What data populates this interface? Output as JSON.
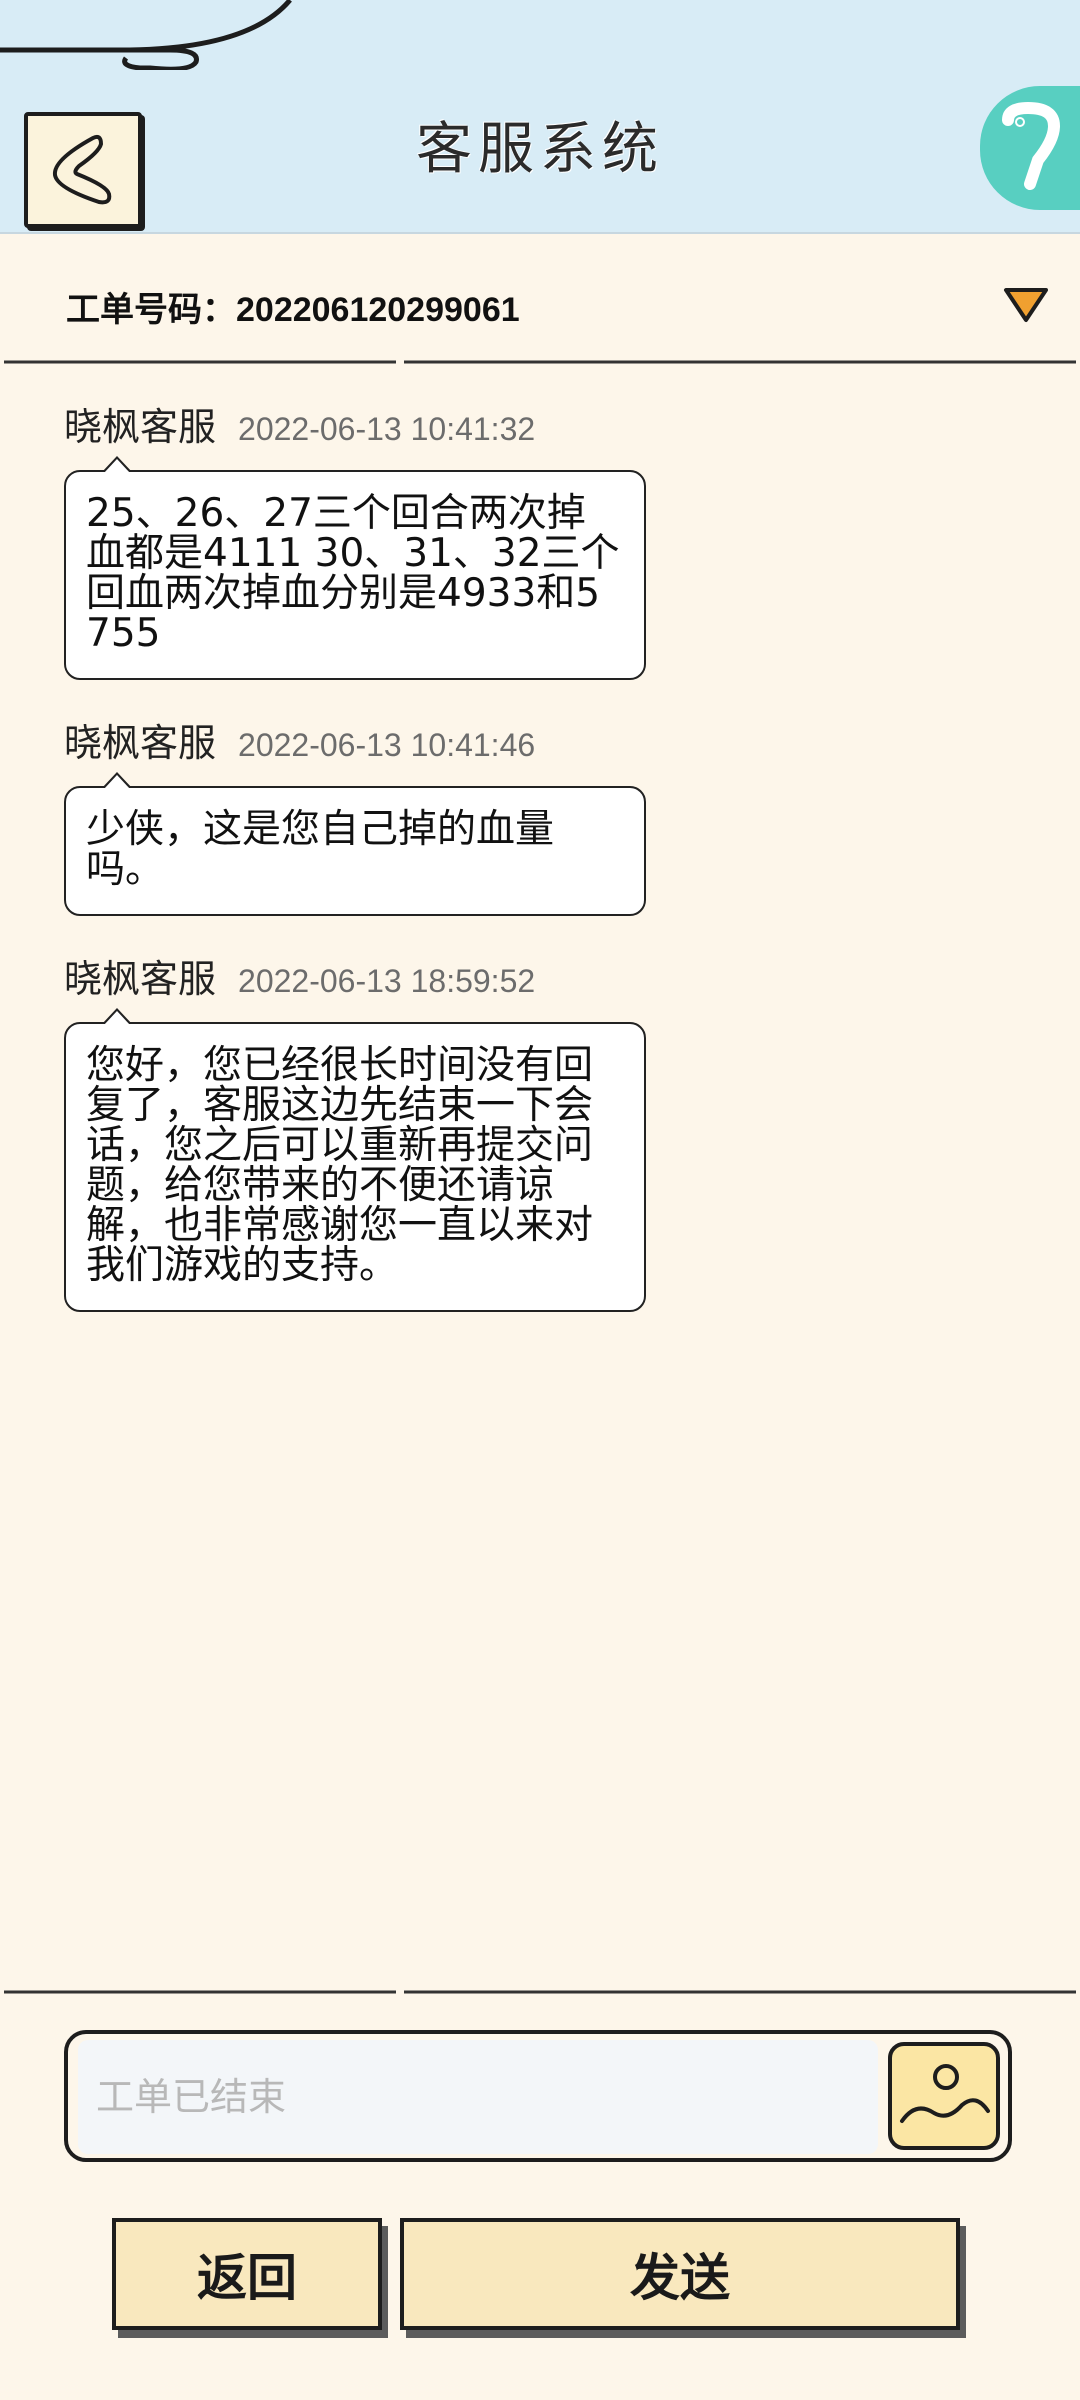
{
  "header": {
    "title": "客服系统",
    "back_icon": "chevron-left-icon",
    "game_icon": "gamepad-icon",
    "bg_color": "#d8ecf6"
  },
  "ticket": {
    "label": "工单号码：202206120299061",
    "toggle_icon": "triangle-down-icon",
    "toggle_color": "#f0a030"
  },
  "messages": [
    {
      "sender": "晓枫客服",
      "time": "2022-06-13 10:41:32",
      "text": "25、26、27三个回合两次掉血都是4111 30、31、32三个回血两次掉血分别是4933和5755"
    },
    {
      "sender": "晓枫客服",
      "time": "2022-06-13 10:41:46",
      "text": "少侠，这是您自己掉的血量吗。"
    },
    {
      "sender": "晓枫客服",
      "time": "2022-06-13 18:59:52",
      "text": "您好，您已经很长时间没有回复了，客服这边先结束一下会话，您之后可以重新再提交问题，给您带来的不便还请谅解，也非常感谢您一直以来对我们游戏的支持。"
    }
  ],
  "input": {
    "placeholder": "工单已结束",
    "image_icon": "image-icon"
  },
  "buttons": {
    "back_label": "返回",
    "send_label": "发送"
  },
  "colors": {
    "page_bg": "#fdf6ea",
    "button_bg": "#f9e8be",
    "accent_teal": "#58cfc1"
  }
}
